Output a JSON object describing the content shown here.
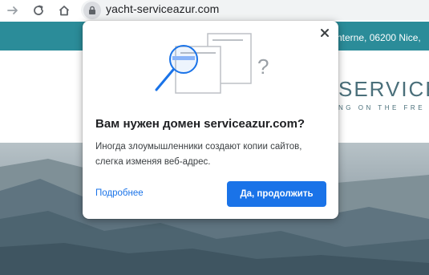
{
  "browser": {
    "url": "yacht-serviceazur.com",
    "icons": {
      "forward": "forward-arrow-icon",
      "reload": "reload-icon",
      "security": "lock-icon"
    }
  },
  "site": {
    "topbar_text": "nterne, 06200 Nice,",
    "logo": "SERVICE A",
    "tagline": "NG ON THE FRE",
    "colors": {
      "topbar": "#2b8c99",
      "logo": "#4a6f7a"
    }
  },
  "popup": {
    "title": "Вам нужен домен serviceazur.com?",
    "body": "Иногда злоумышленники создают копии сайтов, слегка изменяя веб-адрес.",
    "details_link": "Подробнее",
    "continue_button": "Да, продолжить",
    "close_icon": "close-icon",
    "illustration_icon": "magnifier-pages-question-icon",
    "accent_color": "#1a73e8"
  }
}
